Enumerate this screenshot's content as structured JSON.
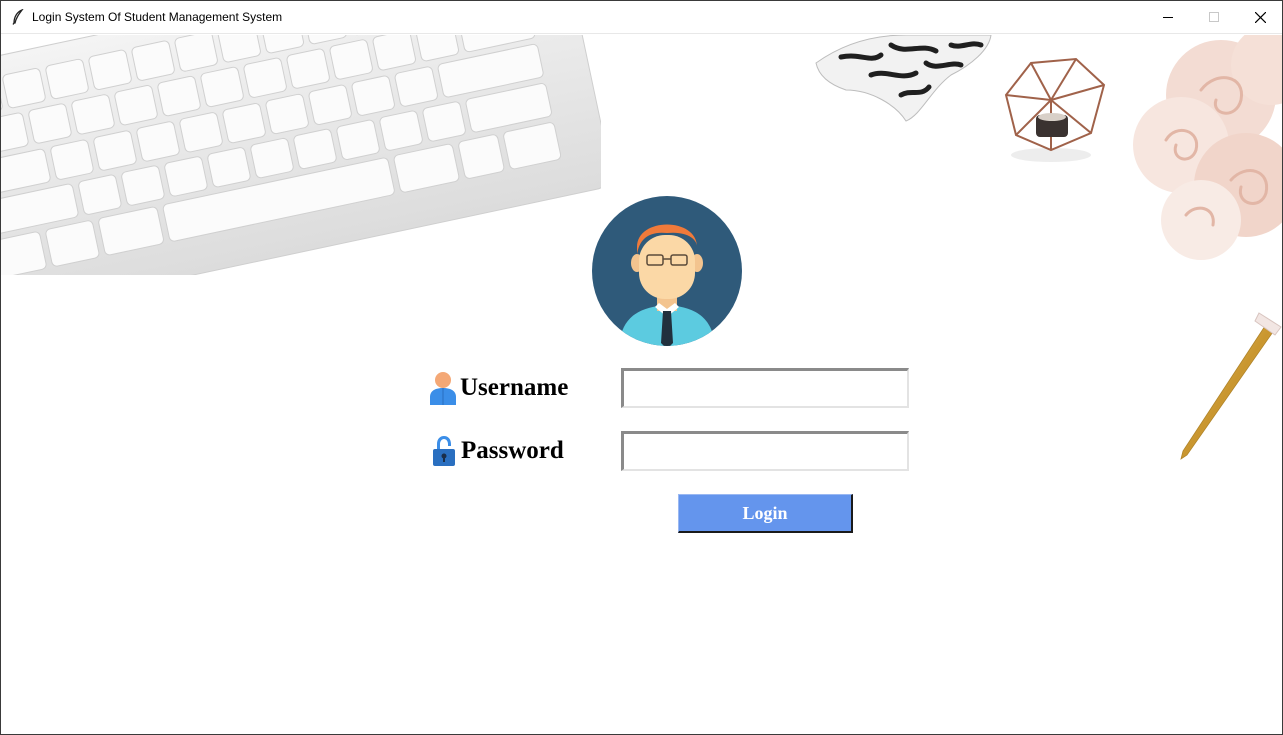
{
  "window": {
    "title": "Login System Of Student Management System",
    "controls": {
      "minimize": "minimize-icon",
      "maximize": "maximize-icon",
      "close": "close-icon"
    }
  },
  "form": {
    "username_label": "Username",
    "username_value": "",
    "password_label": "Password",
    "password_value": "",
    "login_label": "Login"
  },
  "icons": {
    "avatar": "user-avatar-icon",
    "username": "user-icon",
    "password": "lock-icon"
  },
  "colors": {
    "login_button": "#6495ed",
    "avatar_bg": "#2f5a7a"
  }
}
